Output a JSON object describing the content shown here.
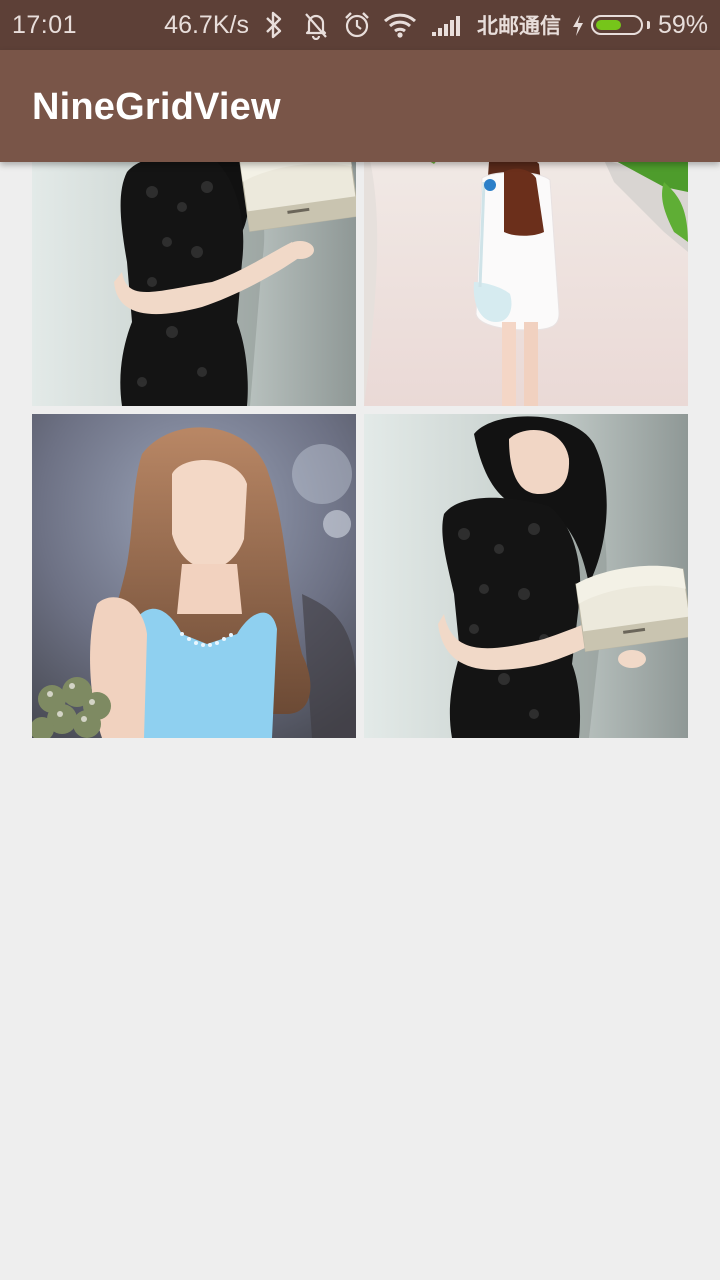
{
  "status_bar": {
    "time": "17:01",
    "net_speed": "46.7K/s",
    "icons": [
      "bluetooth-icon",
      "silent-bell-icon",
      "alarm-icon",
      "wifi-icon",
      "signal-icon",
      "charging-icon",
      "battery-icon"
    ],
    "carrier": "北邮通信",
    "battery_percent": "59%",
    "battery_level": 0.59,
    "battery_color": "#76c51a"
  },
  "app_bar": {
    "title": "NineGridView",
    "color": "#795548"
  },
  "colors": {
    "status_bar": "#5d4037",
    "background": "#eeeeee"
  },
  "grid": {
    "images": [
      {
        "subject": "woman in black lace dress holding a book"
      },
      {
        "subject": "woman in white dress walking on a path"
      },
      {
        "subject": "woman with long hair in light blue dress"
      },
      {
        "subject": "woman in black lace dress holding a book"
      }
    ]
  }
}
